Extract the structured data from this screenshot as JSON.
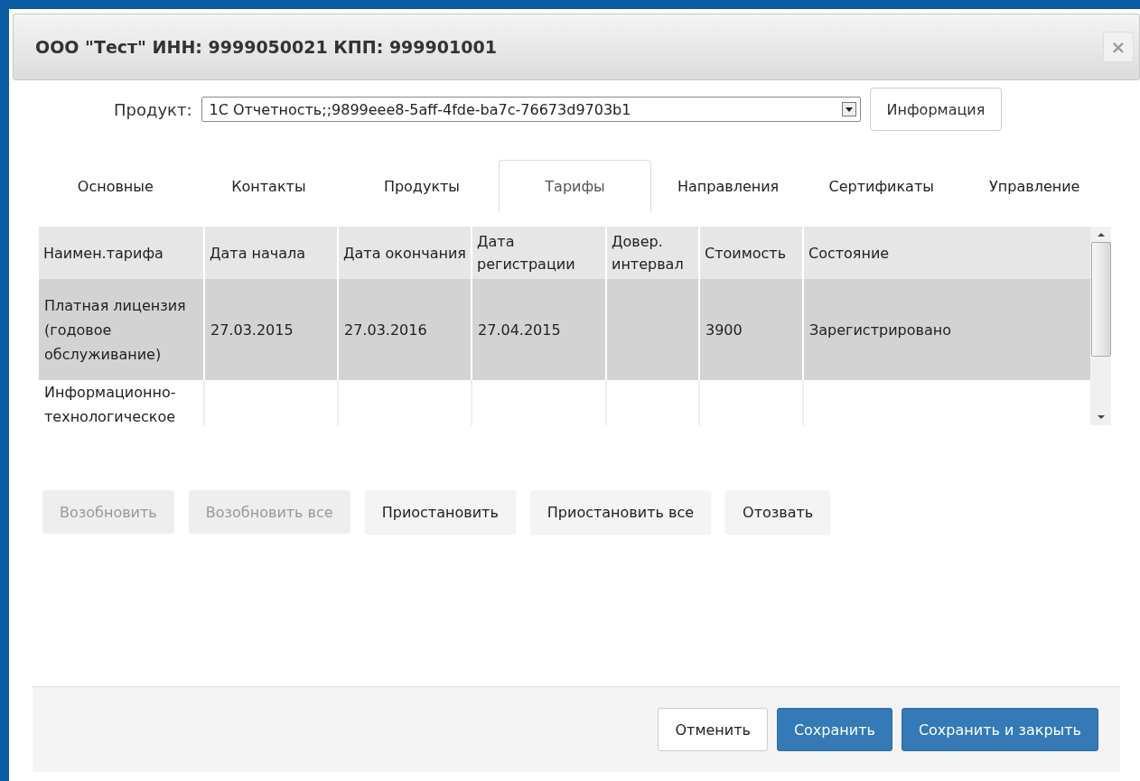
{
  "dialog": {
    "title": "ООО \"Тест\" ИНН: 9999050021 КПП: 999901001",
    "close": "×"
  },
  "product": {
    "label": "Продукт:",
    "value": "1С Отчетность;;9899eee8-5aff-4fde-ba7c-76673d9703b1",
    "info_button": "Информация"
  },
  "tabs": [
    {
      "label": "Основные",
      "selected": false
    },
    {
      "label": "Контакты",
      "selected": false
    },
    {
      "label": "Продукты",
      "selected": false
    },
    {
      "label": "Тарифы",
      "selected": true
    },
    {
      "label": "Направления",
      "selected": false
    },
    {
      "label": "Сертификаты",
      "selected": false
    },
    {
      "label": "Управление",
      "selected": false
    }
  ],
  "table": {
    "columns": [
      "Наимен.тарифа",
      "Дата начала",
      "Дата окончания",
      "Дата регистрации",
      "Довер. интервал",
      "Стоимость",
      "Состояние"
    ],
    "rows": [
      {
        "selected": true,
        "cells": [
          "Платная лицензия (годовое обслуживание)",
          "27.03.2015",
          "27.03.2016",
          "27.04.2015",
          "",
          "3900",
          "Зарегистрировано"
        ]
      },
      {
        "selected": false,
        "cells": [
          "Информационно-технологическое",
          "",
          "",
          "",
          "",
          "",
          ""
        ]
      }
    ]
  },
  "actions": [
    {
      "label": "Возобновить",
      "disabled": true
    },
    {
      "label": "Возобновить все",
      "disabled": true
    },
    {
      "label": "Приостановить",
      "disabled": false
    },
    {
      "label": "Приостановить все",
      "disabled": false
    },
    {
      "label": "Отозвать",
      "disabled": false
    }
  ],
  "footer": [
    {
      "label": "Отменить",
      "kind": "default"
    },
    {
      "label": "Сохранить",
      "kind": "primary"
    },
    {
      "label": "Сохранить и закрыть",
      "kind": "primary"
    }
  ]
}
